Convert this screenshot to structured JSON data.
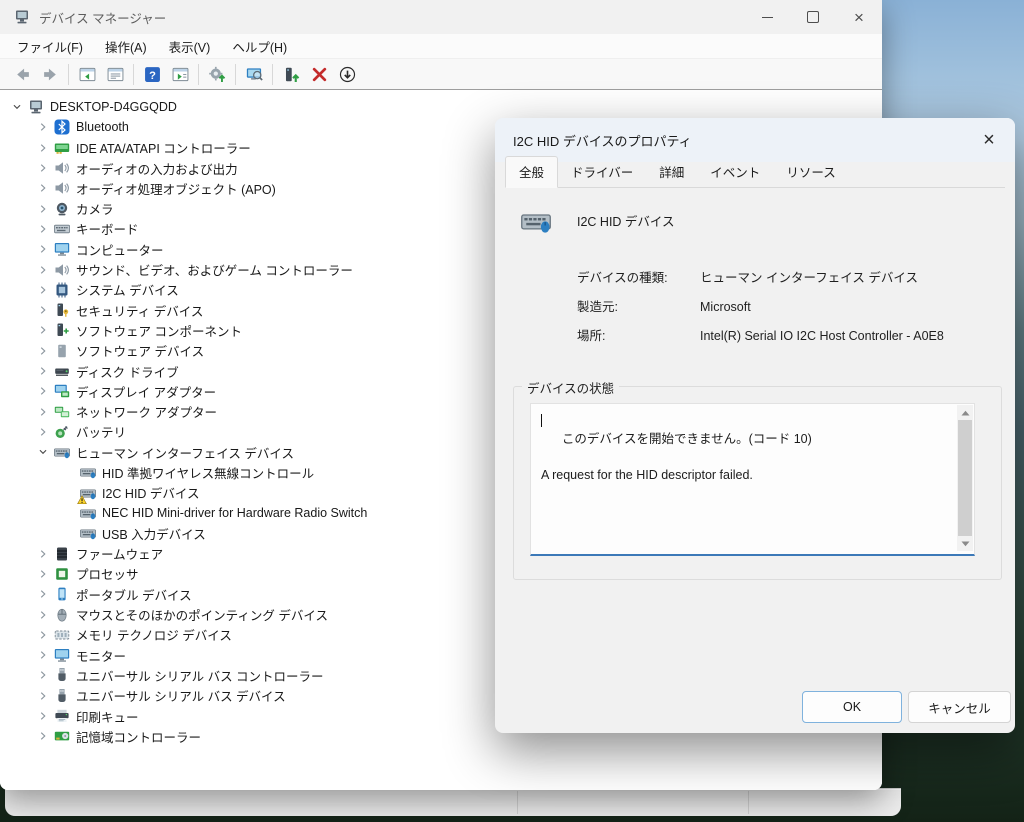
{
  "window": {
    "title": "デバイス マネージャー",
    "menu": [
      "ファイル(F)",
      "操作(A)",
      "表示(V)",
      "ヘルプ(H)"
    ],
    "toolbar": [
      "back",
      "forward",
      "sep",
      "console-tree",
      "properties",
      "sep",
      "help",
      "action-pane",
      "sep",
      "scan-hardware-changes",
      "sep",
      "remote-computer",
      "sep",
      "update-driver",
      "uninstall-device",
      "disable-device"
    ]
  },
  "tree": {
    "items": [
      {
        "level": 0,
        "chevron": "expanded",
        "icon": "computer",
        "label": "DESKTOP-D4GGQDD"
      },
      {
        "level": 1,
        "chevron": "collapsed",
        "icon": "bluetooth",
        "label": "Bluetooth"
      },
      {
        "level": 1,
        "chevron": "collapsed",
        "icon": "ide",
        "label": "IDE ATA/ATAPI コントローラー"
      },
      {
        "level": 1,
        "chevron": "collapsed",
        "icon": "audio",
        "label": "オーディオの入力および出力"
      },
      {
        "level": 1,
        "chevron": "collapsed",
        "icon": "audio",
        "label": "オーディオ処理オブジェクト (APO)"
      },
      {
        "level": 1,
        "chevron": "collapsed",
        "icon": "camera",
        "label": "カメラ"
      },
      {
        "level": 1,
        "chevron": "collapsed",
        "icon": "keyboard",
        "label": "キーボード"
      },
      {
        "level": 1,
        "chevron": "collapsed",
        "icon": "monitor",
        "label": "コンピューター"
      },
      {
        "level": 1,
        "chevron": "collapsed",
        "icon": "audio",
        "label": "サウンド、ビデオ、およびゲーム コントローラー"
      },
      {
        "level": 1,
        "chevron": "collapsed",
        "icon": "chip",
        "label": "システム デバイス"
      },
      {
        "level": 1,
        "chevron": "collapsed",
        "icon": "security",
        "label": "セキュリティ デバイス"
      },
      {
        "level": 1,
        "chevron": "collapsed",
        "icon": "swcomp",
        "label": "ソフトウェア コンポーネント"
      },
      {
        "level": 1,
        "chevron": "collapsed",
        "icon": "swdev",
        "label": "ソフトウェア デバイス"
      },
      {
        "level": 1,
        "chevron": "collapsed",
        "icon": "disk",
        "label": "ディスク ドライブ"
      },
      {
        "level": 1,
        "chevron": "collapsed",
        "icon": "display",
        "label": "ディスプレイ アダプター"
      },
      {
        "level": 1,
        "chevron": "collapsed",
        "icon": "network",
        "label": "ネットワーク アダプター"
      },
      {
        "level": 1,
        "chevron": "collapsed",
        "icon": "battery",
        "label": "バッテリ"
      },
      {
        "level": 1,
        "chevron": "expanded",
        "icon": "hid",
        "label": "ヒューマン インターフェイス デバイス"
      },
      {
        "level": 2,
        "chevron": "",
        "icon": "hid",
        "label": "HID 準拠ワイヤレス無線コントロール"
      },
      {
        "level": 2,
        "chevron": "",
        "icon": "hid",
        "label": "I2C HID デバイス",
        "warning": true
      },
      {
        "level": 2,
        "chevron": "",
        "icon": "hid",
        "label": "NEC HID Mini-driver for Hardware Radio Switch"
      },
      {
        "level": 2,
        "chevron": "",
        "icon": "hid",
        "label": "USB 入力デバイス"
      },
      {
        "level": 1,
        "chevron": "collapsed",
        "icon": "firmware",
        "label": "ファームウェア"
      },
      {
        "level": 1,
        "chevron": "collapsed",
        "icon": "processor",
        "label": "プロセッサ"
      },
      {
        "level": 1,
        "chevron": "collapsed",
        "icon": "portable",
        "label": "ポータブル デバイス"
      },
      {
        "level": 1,
        "chevron": "collapsed",
        "icon": "mouse",
        "label": "マウスとそのほかのポインティング デバイス"
      },
      {
        "level": 1,
        "chevron": "collapsed",
        "icon": "memory",
        "label": "メモリ テクノロジ デバイス"
      },
      {
        "level": 1,
        "chevron": "collapsed",
        "icon": "monitor",
        "label": "モニター"
      },
      {
        "level": 1,
        "chevron": "collapsed",
        "icon": "usb",
        "label": "ユニバーサル シリアル バス コントローラー"
      },
      {
        "level": 1,
        "chevron": "collapsed",
        "icon": "usb",
        "label": "ユニバーサル シリアル バス デバイス"
      },
      {
        "level": 1,
        "chevron": "collapsed",
        "icon": "printer",
        "label": "印刷キュー"
      },
      {
        "level": 1,
        "chevron": "collapsed",
        "icon": "storage",
        "label": "記憶域コントローラー"
      }
    ]
  },
  "dialog": {
    "title": "I2C HID デバイスのプロパティ",
    "tabs": [
      {
        "label": "全般",
        "active": true
      },
      {
        "label": "ドライバー",
        "active": false
      },
      {
        "label": "詳細",
        "active": false
      },
      {
        "label": "イベント",
        "active": false
      },
      {
        "label": "リソース",
        "active": false
      }
    ],
    "device_name": "I2C HID デバイス",
    "fields": [
      {
        "label": "デバイスの種類:",
        "value": "ヒューマン インターフェイス デバイス"
      },
      {
        "label": "製造元:",
        "value": "Microsoft"
      },
      {
        "label": "場所:",
        "value": "Intel(R) Serial IO I2C Host Controller - A0E8"
      }
    ],
    "status_group_label": "デバイスの状態",
    "status_lines": [
      "このデバイスを開始できません。(コード 10)",
      "",
      "A request for the HID descriptor failed."
    ],
    "buttons": {
      "ok": "OK",
      "cancel": "キャンセル"
    }
  },
  "colors": {
    "focus_underline": "#3c79b8",
    "ok_border": "#7fb2dd",
    "warning_yellow": "#fad32b",
    "uninstall_red": "#c42b2b"
  }
}
